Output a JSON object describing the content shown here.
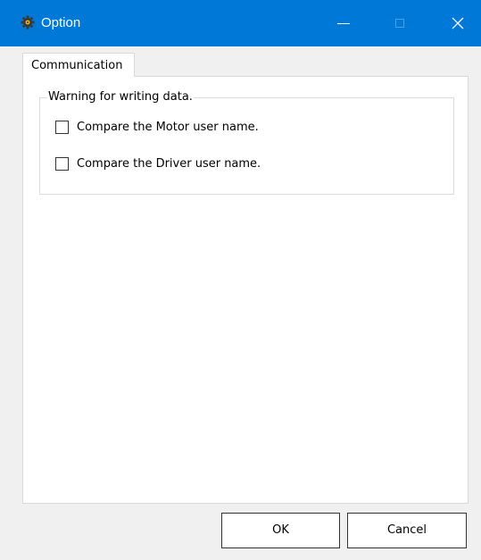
{
  "window": {
    "title": "Option",
    "title_icon": "gear-icon",
    "titlebar_color": "#0078d7",
    "controls": {
      "minimize_icon": "minimize-icon",
      "maximize_icon": "maximize-icon",
      "close_icon": "close-icon"
    }
  },
  "tabs": [
    {
      "label": "Communication",
      "selected": true
    }
  ],
  "group": {
    "legend": "Warning for writing data.",
    "options": [
      {
        "label": "Compare the Motor user name.",
        "checked": false
      },
      {
        "label": "Compare the Driver user name.",
        "checked": false
      }
    ]
  },
  "buttons": {
    "ok": "OK",
    "cancel": "Cancel"
  }
}
